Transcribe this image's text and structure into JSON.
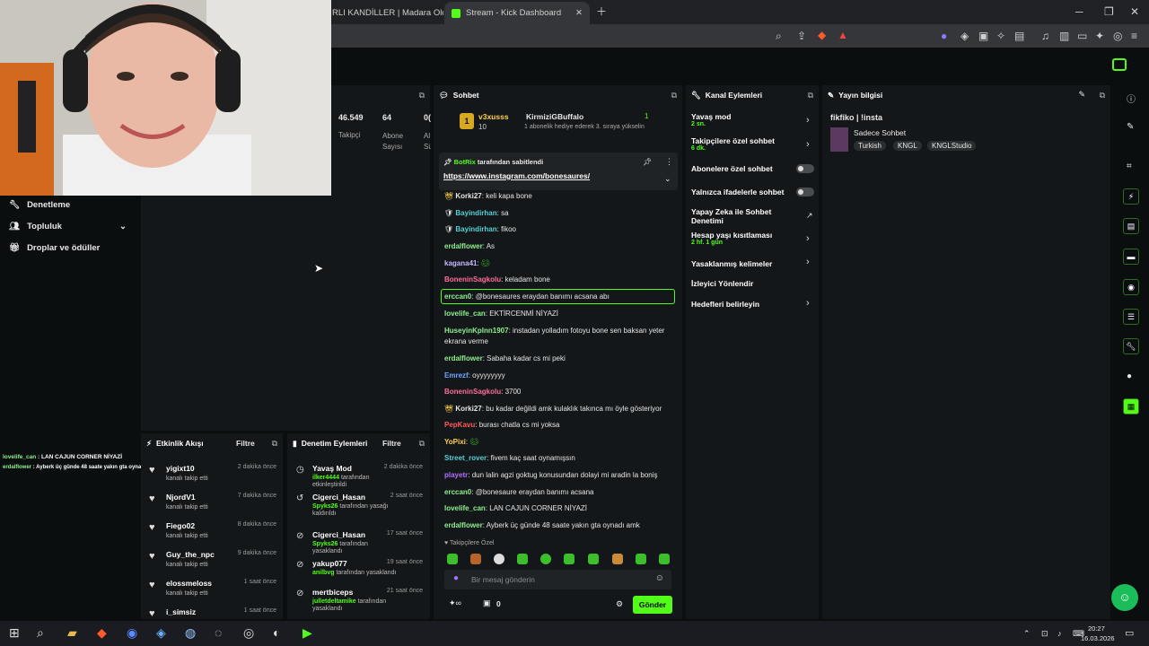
{
  "tabs": [
    {
      "label": "RLI KANDİLLER | Madara Olduk"
    },
    {
      "label": "Stream - Kick Dashboard"
    }
  ],
  "sidebar": {
    "items": [
      {
        "label": "Denetleme"
      },
      {
        "label": "Topluluk"
      },
      {
        "label": "Droplar ve ödüller"
      }
    ]
  },
  "stats": [
    {
      "value": "46.549",
      "label": "Takipçi"
    },
    {
      "value": "64",
      "label": "Abone Sayısı"
    },
    {
      "value": "0(",
      "label": "Al Sü"
    }
  ],
  "chat": {
    "title": "Sohbet",
    "top_user": {
      "name": "v3xusss",
      "count": "10",
      "gifter": "KirmiziGBuffalo",
      "gift_count": "1",
      "note": "1 abonelik hediye ederek 3. sıraya yükselin"
    },
    "pinned": {
      "by": "BotRix",
      "by_suffix": "tarafından sabitlendi",
      "link": "https://www.instagram.com/bonesaures/"
    },
    "messages": [
      {
        "user": "Korki27",
        "color": "#ffffff",
        "text": "keli kapa bone"
      },
      {
        "user": "Bayindirhan",
        "color": "#53d0d5",
        "text": "sa"
      },
      {
        "user": "Bayindirhan",
        "color": "#53d0d5",
        "text": "fikoo"
      },
      {
        "user": "erdalflower",
        "color": "#8ef08e",
        "text": "As"
      },
      {
        "user": "kagana41",
        "color": "#c2b8ff",
        "text": ""
      },
      {
        "user": "BoneninSagkolu",
        "color": "#ff6b9a",
        "text": "keladam bone"
      },
      {
        "user": "erccan0",
        "color": "#8ef08e",
        "text": "@bonesaures eraydan banımı acsana abı"
      },
      {
        "user": "lovelife_can",
        "color": "#8ef08e",
        "text": "EKTİRCENMİ NİYAZİ"
      },
      {
        "user": "HuseyinKplnn1907",
        "color": "#8ef08e",
        "text": "instadan yolladım fotoyu bone sen baksan yeter ekrana verme"
      },
      {
        "user": "erdalflower",
        "color": "#8ef08e",
        "text": "Sabaha kadar cs mi peki"
      },
      {
        "user": "Emrezf",
        "color": "#6ea8ff",
        "text": "oyyyyyyyy"
      },
      {
        "user": "BoneninSagkolu",
        "color": "#ff6b9a",
        "text": "3700"
      },
      {
        "user": "Korki27",
        "color": "#ffffff",
        "text": "bu kadar değildi amk kulaklık takınca mı öyle gösteriyor"
      },
      {
        "user": "PepKavu",
        "color": "#ff5a5a",
        "text": "burası chatla cs mi yoksa"
      },
      {
        "user": "YoPixi",
        "color": "#ffd24a",
        "text": ""
      },
      {
        "user": "Street_rover",
        "color": "#53d0d5",
        "text": "fivem kaç saat oynamışsın"
      },
      {
        "user": "playetr",
        "color": "#b070ff",
        "text": "dun lalin agzi goktug konusundan dolayi mi aradin la boniş"
      },
      {
        "user": "erccan0",
        "color": "#8ef08e",
        "text": "@bonesaure eraydan banımı acsana"
      },
      {
        "user": "lovelife_can",
        "color": "#8ef08e",
        "text": "LAN CAJUN CORNER NİYAZİ"
      },
      {
        "user": "erdalflower",
        "color": "#8ef08e",
        "text": "Ayberk üç günde 48 saate yakın gta oynadı amk"
      }
    ],
    "followers_only": "Takipçilere Özel",
    "input_placeholder": "Bir mesaj gönderin",
    "points": "0",
    "send": "Gönder"
  },
  "actions": {
    "title": "Kanal Eylemleri",
    "items": [
      {
        "label": "Yavaş mod",
        "sub": "2 sn."
      },
      {
        "label": "Takipçilere özel sohbet",
        "sub": "6 dk."
      },
      {
        "label": "Abonelere özel sohbet",
        "sub": ""
      },
      {
        "label": "Yalnızca ifadelerle sohbet",
        "sub": ""
      },
      {
        "label": "Yapay Zeka ile Sohbet Denetimi",
        "sub": ""
      },
      {
        "label": "Hesap yaşı kısıtlaması",
        "sub": "2 hf. 1 gün"
      },
      {
        "label": "Yasaklanmış kelimeler",
        "sub": ""
      },
      {
        "label": "İzleyici Yönlendir",
        "sub": ""
      },
      {
        "label": "Hedefleri belirleyin",
        "sub": ""
      }
    ]
  },
  "stream_info": {
    "title": "Yayın bilgisi",
    "stream_title": "fikfiko | !insta",
    "category": "Sadece Sohbet",
    "tags": [
      "Turkish",
      "KNGL",
      "KNGLStudio"
    ]
  },
  "activity": {
    "title": "Etkinlik Akışı",
    "filter": "Filtre",
    "items": [
      {
        "name": "yigixt10",
        "sub": "kanalı takip etti",
        "time": "2 dakika önce"
      },
      {
        "name": "NjordV1",
        "sub": "kanalı takip etti",
        "time": "7 dakika önce"
      },
      {
        "name": "Fiego02",
        "sub": "kanalı takip etti",
        "time": "8 dakika önce"
      },
      {
        "name": "Guy_the_npc",
        "sub": "kanalı takip etti",
        "time": "9 dakika önce"
      },
      {
        "name": "elossmeloss",
        "sub": "kanalı takip etti",
        "time": "1 saat önce"
      },
      {
        "name": "i_simsiz",
        "sub": "",
        "time": "1 saat önce"
      }
    ]
  },
  "modlog": {
    "title": "Denetim Eylemleri",
    "filter": "Filtre",
    "items": [
      {
        "name": "Yavaş Mod",
        "actor": "ilker4444",
        "action": "tarafından etkinleştirildi",
        "time": "2 dakika önce"
      },
      {
        "name": "Cigerci_Hasan",
        "actor": "Spyks26",
        "action": "tarafından yasağı kaldırıldı",
        "time": "2 saat önce"
      },
      {
        "name": "Cigerci_Hasan",
        "actor": "Spyks26",
        "action": "tarafından yasaklandı",
        "time": "17 saat önce"
      },
      {
        "name": "yakup077",
        "actor": "anilbvg",
        "action": "tarafından yasaklandı",
        "time": "19 saat önce"
      },
      {
        "name": "mertbiceps",
        "actor": "julletdeltamike",
        "action": "tarafından yasaklandı",
        "time": "21 saat önce"
      }
    ]
  },
  "overlay_chat": [
    {
      "user": "lovelife_can",
      "text": "LAN CAJUN CORNER NİYAZİ"
    },
    {
      "user": "erdalflower",
      "text": "Ayberk üç günde 48 saate yakın gta oynadı amk"
    }
  ],
  "clock": {
    "time": "20:27",
    "date": "16.03.2026"
  }
}
